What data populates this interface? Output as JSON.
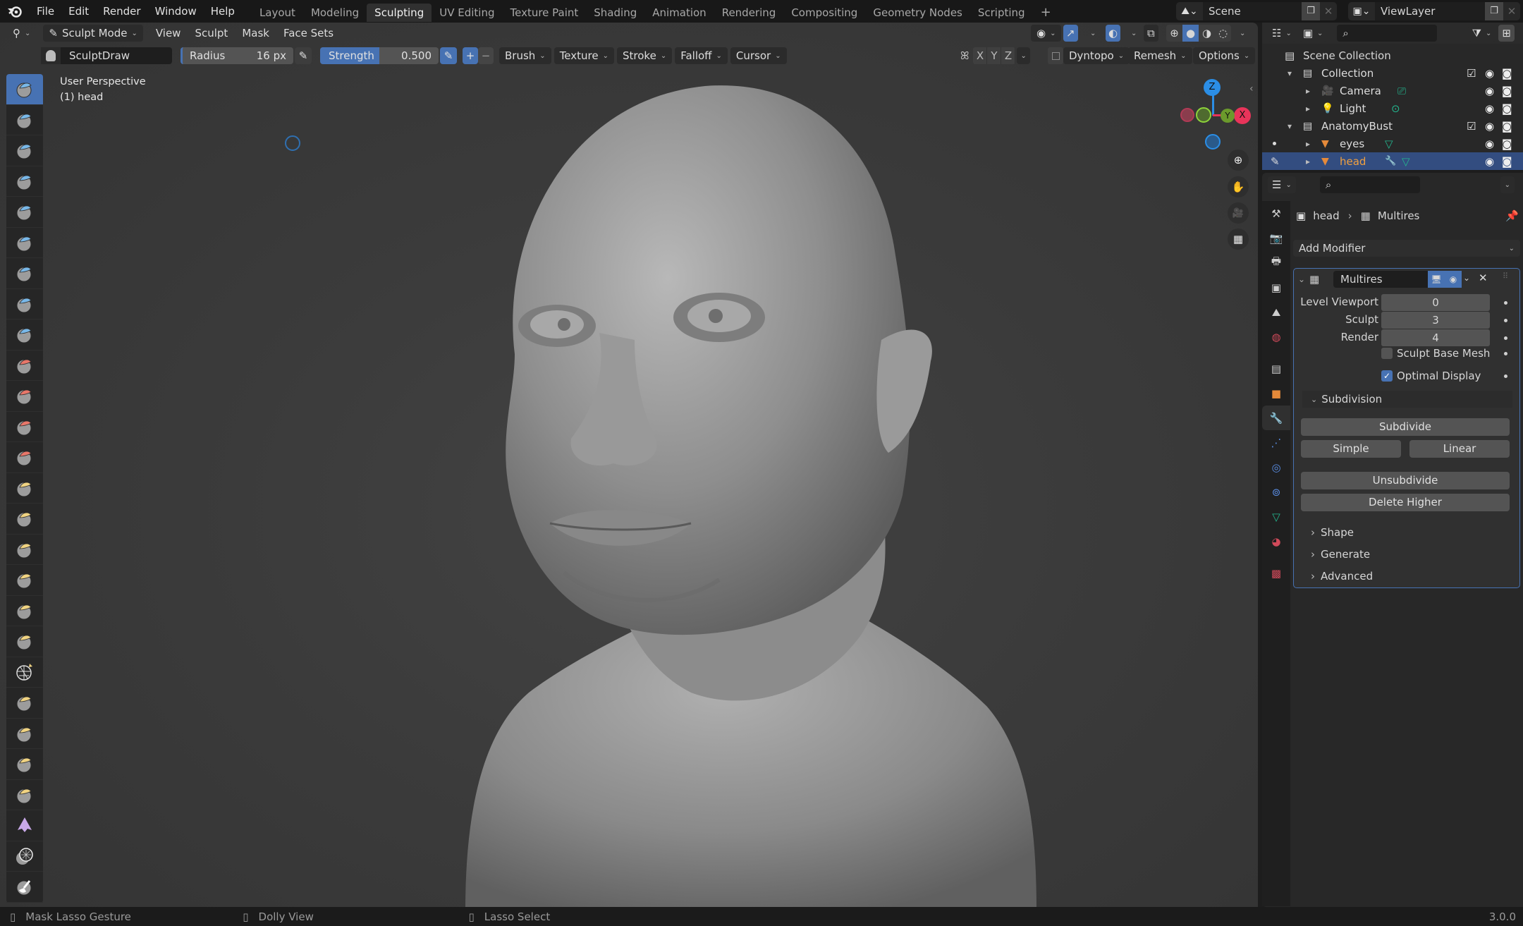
{
  "app": {
    "name": "Blender",
    "version": "3.0.0"
  },
  "topbar": {
    "menus": [
      "File",
      "Edit",
      "Render",
      "Window",
      "Help"
    ],
    "workspaces": [
      "Layout",
      "Modeling",
      "Sculpting",
      "UV Editing",
      "Texture Paint",
      "Shading",
      "Animation",
      "Rendering",
      "Compositing",
      "Geometry Nodes",
      "Scripting"
    ],
    "active_workspace": "Sculpting",
    "add_workspace": "+",
    "scene": "Scene",
    "view_layer": "ViewLayer"
  },
  "viewport_header": {
    "mode": "Sculpt Mode",
    "menus": [
      "View",
      "Sculpt",
      "Mask",
      "Face Sets"
    ]
  },
  "tool_header": {
    "brush_name": "SculptDraw",
    "radius_label": "Radius",
    "radius_value": "16 px",
    "strength_label": "Strength",
    "strength_value": "0.500",
    "strength_fraction": 0.5,
    "direction_add": "+",
    "direction_sub": "−",
    "dropdowns": [
      "Brush",
      "Texture",
      "Stroke",
      "Falloff",
      "Cursor"
    ],
    "symmetry_axes": [
      "X",
      "Y",
      "Z"
    ],
    "dyntopo_label": "Dyntopo",
    "dyntopo_enabled": false,
    "remesh_label": "Remesh",
    "options_label": "Options"
  },
  "viewport": {
    "view_name": "User Perspective",
    "object_info": "(1) head",
    "gizmo_axes": {
      "x": "X",
      "y": "Y",
      "z": "Z"
    },
    "colors": {
      "x": "#e8345a",
      "y": "#7ac82e",
      "z": "#2b8ee6"
    }
  },
  "toolbar": {
    "tools": [
      {
        "name": "draw",
        "color": "#79b8e8"
      },
      {
        "name": "draw-sharp",
        "color": "#79b8e8"
      },
      {
        "name": "clay",
        "color": "#79b8e8"
      },
      {
        "name": "clay-strips",
        "color": "#79b8e8"
      },
      {
        "name": "clay-thumb",
        "color": "#79b8e8"
      },
      {
        "name": "layer",
        "color": "#79b8e8"
      },
      {
        "name": "inflate",
        "color": "#79b8e8"
      },
      {
        "name": "blob",
        "color": "#79b8e8"
      },
      {
        "name": "crease",
        "color": "#79b8e8"
      },
      {
        "name": "smooth",
        "color": "#e8776a"
      },
      {
        "name": "flatten",
        "color": "#e8776a"
      },
      {
        "name": "fill",
        "color": "#e8776a"
      },
      {
        "name": "scrape",
        "color": "#e8776a"
      },
      {
        "name": "multiplane-scrape",
        "color": "#f0d382"
      },
      {
        "name": "pinch",
        "color": "#f0d382"
      },
      {
        "name": "grab",
        "color": "#f0d382"
      },
      {
        "name": "elastic-deform",
        "color": "#f0d382"
      },
      {
        "name": "snake-hook",
        "color": "#f0d382"
      },
      {
        "name": "thumb",
        "color": "#f0d382"
      },
      {
        "name": "pose",
        "color": "#f0d382"
      },
      {
        "name": "nudge",
        "color": "#f0d382"
      },
      {
        "name": "rotate",
        "color": "#f0d382"
      },
      {
        "name": "slide-relax",
        "color": "#f0d382"
      },
      {
        "name": "boundary",
        "color": "#f0d382"
      },
      {
        "name": "cloth",
        "color": "#c8a8e8"
      },
      {
        "name": "simplify",
        "color": "#d0d0d0"
      },
      {
        "name": "mask",
        "color": "#ffffff"
      }
    ],
    "active_tool": "draw"
  },
  "outliner": {
    "search_placeholder": "",
    "root": "Scene Collection",
    "rows": [
      {
        "label": "Collection",
        "type": "collection",
        "level": 1,
        "expanded": true,
        "checkbox": true
      },
      {
        "label": "Camera",
        "type": "camera",
        "level": 2,
        "expanded": false,
        "checkbox": false
      },
      {
        "label": "Light",
        "type": "light",
        "level": 2,
        "expanded": false,
        "checkbox": false
      },
      {
        "label": "AnatomyBust",
        "type": "collection",
        "level": 1,
        "expanded": true,
        "checkbox": true
      },
      {
        "label": "eyes",
        "type": "mesh",
        "level": 2,
        "expanded": false,
        "checkbox": false
      },
      {
        "label": "head",
        "type": "mesh",
        "level": 2,
        "expanded": false,
        "checkbox": false,
        "selected": true
      }
    ]
  },
  "properties": {
    "search_placeholder": "",
    "breadcrumb": [
      "head",
      "Multires"
    ],
    "add_modifier_label": "Add Modifier",
    "modifier": {
      "name": "Multires",
      "fields": [
        {
          "label": "Level Viewport",
          "value": "0"
        },
        {
          "label": "Sculpt",
          "value": "3"
        },
        {
          "label": "Render",
          "value": "4"
        }
      ],
      "checkboxes": [
        {
          "label": "Sculpt Base Mesh",
          "checked": false
        },
        {
          "label": "Optimal Display",
          "checked": true
        }
      ],
      "subdivision_label": "Subdivision",
      "subdivide_label": "Subdivide",
      "simple_label": "Simple",
      "linear_label": "Linear",
      "unsubdivide_label": "Unsubdivide",
      "delete_higher_label": "Delete Higher",
      "collapsed_panels": [
        "Shape",
        "Generate",
        "Advanced"
      ]
    },
    "tabs": [
      "tool",
      "render",
      "output",
      "view-layer",
      "scene",
      "world",
      "collection",
      "object",
      "modifiers",
      "particles",
      "physics",
      "constraints",
      "data",
      "material",
      "texture"
    ],
    "active_tab": "modifiers"
  },
  "statusbar": {
    "left": "Mask Lasso Gesture",
    "middle": "Dolly View",
    "right": "Lasso Select",
    "version": "3.0.0"
  }
}
